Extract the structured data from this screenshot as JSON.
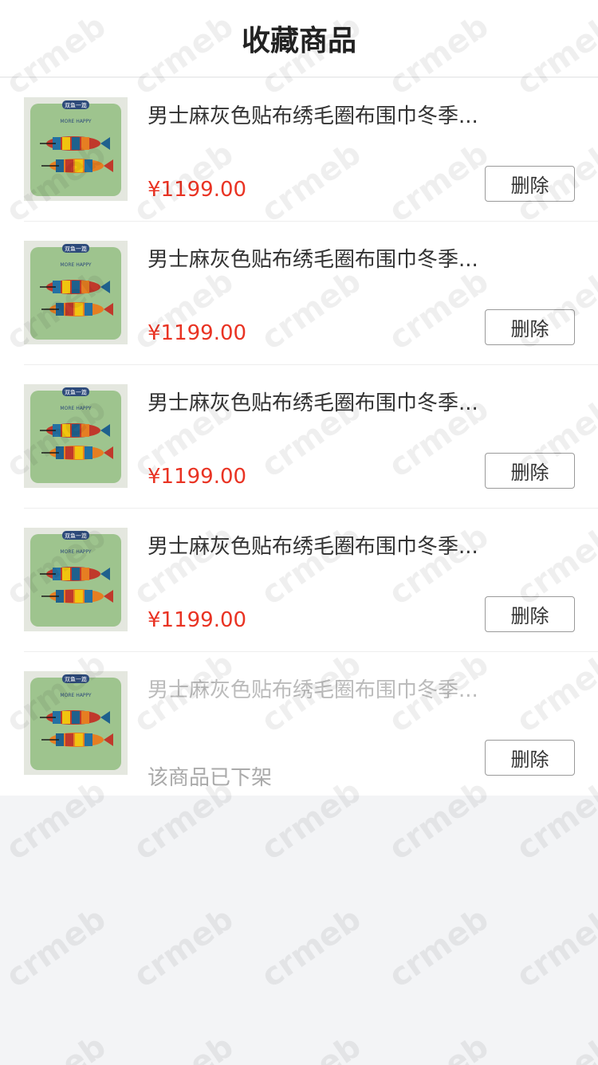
{
  "header": {
    "title": "收藏商品"
  },
  "colors": {
    "price": "#e93323",
    "background": "#f3f4f6",
    "offline_text": "#bbbbbb"
  },
  "items": [
    {
      "title": "男士麻灰色贴布绣毛圈布围巾冬季...",
      "price": "¥1199.00",
      "delete_label": "删除",
      "thumb_badge": "双鱼一篇",
      "thumb_text": "MORE HAPPY"
    },
    {
      "title": "男士麻灰色贴布绣毛圈布围巾冬季...",
      "price": "¥1199.00",
      "delete_label": "删除",
      "thumb_badge": "双鱼一篇",
      "thumb_text": "MORE HAPPY"
    },
    {
      "title": "男士麻灰色贴布绣毛圈布围巾冬季...",
      "price": "¥1199.00",
      "delete_label": "删除",
      "thumb_badge": "双鱼一篇",
      "thumb_text": "MORE HAPPY"
    },
    {
      "title": "男士麻灰色贴布绣毛圈布围巾冬季...",
      "price": "¥1199.00",
      "delete_label": "删除",
      "thumb_badge": "双鱼一篇",
      "thumb_text": "MORE HAPPY"
    },
    {
      "title": "男士麻灰色贴布绣毛圈布围巾冬季...",
      "status": "该商品已下架",
      "delete_label": "删除",
      "thumb_badge": "双鱼一篇",
      "thumb_text": "MORE HAPPY"
    }
  ],
  "watermark": "crmeb"
}
